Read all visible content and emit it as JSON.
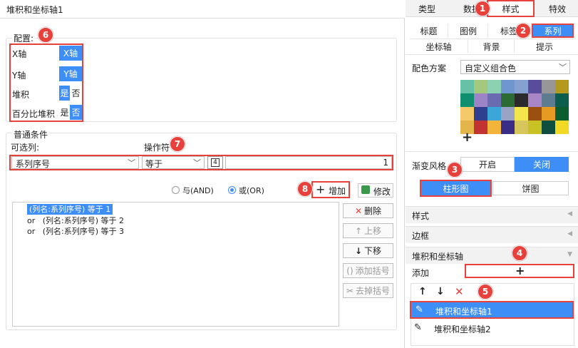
{
  "title": "堆积和坐标轴1",
  "config": {
    "label": "配置:",
    "rows": [
      {
        "name": "X轴",
        "on": "X轴",
        "off": ""
      },
      {
        "name": "Y轴",
        "on": "Y轴",
        "off": ""
      },
      {
        "name": "堆积",
        "on": "是",
        "off": "否"
      },
      {
        "name": "百分比堆积",
        "on": "是",
        "off": "否"
      }
    ]
  },
  "condition": {
    "label": "普通条件",
    "optional_label": "可选列:",
    "operator_label": "操作符",
    "column_value": "系列序号",
    "operator_value": "等于",
    "value": "1",
    "and_label": "与(AND)",
    "or_label": "或(OR)",
    "add_label": "增加",
    "edit_label": "修改",
    "list": [
      {
        "text": "(列名:系列序号) 等于 1",
        "prefix": ""
      },
      {
        "text": "(列名:系列序号) 等于 2",
        "prefix": "or"
      },
      {
        "text": "(列名:系列序号) 等于 3",
        "prefix": "or"
      }
    ],
    "buttons": {
      "delete": "删除",
      "up": "上移",
      "down": "下移",
      "add_bracket": "添加括号",
      "remove_bracket": "去掉括号"
    }
  },
  "right": {
    "tabs": [
      "类型",
      "数据",
      "样式",
      "特效"
    ],
    "subtabs_row1": [
      "标题",
      "图例",
      "标签",
      "系列"
    ],
    "subtabs_row2": [
      "坐标轴",
      "背景",
      "提示"
    ],
    "color_scheme_label": "配色方案",
    "color_scheme_value": "自定义组合色",
    "gradient_label": "渐变风格",
    "gradient_on": "开启",
    "gradient_off": "关闭",
    "chart_types": [
      "柱形图",
      "饼图"
    ],
    "sections": [
      "样式",
      "边框",
      "堆积和坐标轴"
    ],
    "add_label": "添加",
    "items": [
      "堆积和坐标轴1",
      "堆积和坐标轴2"
    ],
    "colors": [
      "#67c1a7",
      "#a4c97c",
      "#8bd1b2",
      "#6f96cf",
      "#84a1cf",
      "#5a4c9c",
      "#979797",
      "#b39a1c",
      "#0e8f70",
      "#9d84c7",
      "#6a6bb0",
      "#2c6b33",
      "#2b2b2b",
      "#a986c6",
      "#5e7c91",
      "#0b5e4e",
      "#f4c96a",
      "#2f3e8e",
      "#3ba7d8",
      "#9aa3c6",
      "#f3e64c",
      "#9b4f11",
      "#e59a21",
      "#0c5e2f",
      "#e3b54a",
      "#c23232",
      "#f2b43a",
      "#3a2d86",
      "#d7c65c",
      "#c9c224",
      "#0f4f3f",
      "#f2da24"
    ]
  },
  "badges": [
    "1",
    "2",
    "3",
    "4",
    "5",
    "6",
    "7",
    "8"
  ]
}
